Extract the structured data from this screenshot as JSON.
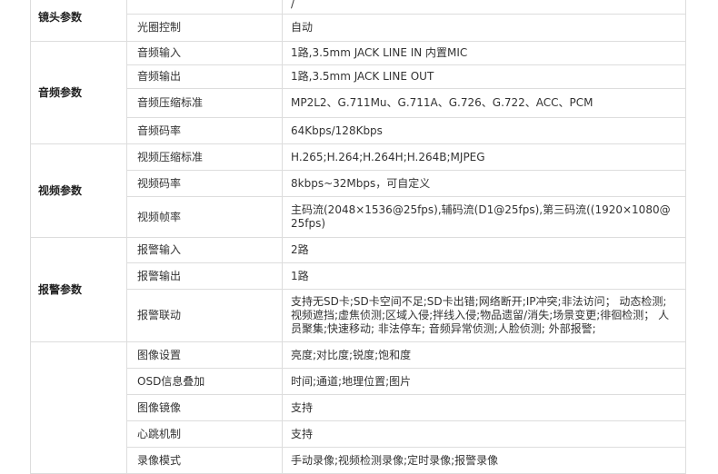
{
  "groups": [
    {
      "category": "镜头参数",
      "rows": [
        {
          "name": "",
          "value": "/"
        },
        {
          "name": "光圈控制",
          "value": "自动"
        }
      ]
    },
    {
      "category": "音频参数",
      "rows": [
        {
          "name": "音频输入",
          "value": "1路,3.5mm JACK LINE IN 内置MIC"
        },
        {
          "name": "音频输出",
          "value": "1路,3.5mm JACK LINE OUT"
        },
        {
          "name": "音频压缩标准",
          "value": "MP2L2、G.711Mu、G.711A、G.726、G.722、ACC、PCM"
        },
        {
          "name": "音频码率",
          "value": "64Kbps/128Kbps"
        }
      ]
    },
    {
      "category": "视频参数",
      "rows": [
        {
          "name": "视频压缩标准",
          "value": "H.265;H.264;H.264H;H.264B;MJPEG"
        },
        {
          "name": "视频码率",
          "value": "8kbps~32Mbps，可自定义"
        },
        {
          "name": "视频帧率",
          "value": "主码流(2048×1536@25fps),辅码流(D1@25fps),第三码流((1920×1080@25fps)"
        }
      ]
    },
    {
      "category": "报警参数",
      "rows": [
        {
          "name": "报警输入",
          "value": "2路"
        },
        {
          "name": "报警输出",
          "value": "1路"
        },
        {
          "name": "报警联动",
          "value": "支持无SD卡;SD卡空间不足;SD卡出错;网络断开;IP冲突;非法访问； 动态检测;视频遮挡;虚焦侦测;区域入侵;拌线入侵;物品遗留/消失;场景变更;徘徊检测； 人员聚集;快速移动; 非法停车; 音频异常侦测;人脸侦测; 外部报警;"
        }
      ]
    },
    {
      "category": "",
      "rows": [
        {
          "name": "图像设置",
          "value": "亮度;对比度;锐度;饱和度"
        },
        {
          "name": "OSD信息叠加",
          "value": "时间;通道;地理位置;图片"
        },
        {
          "name": "图像镜像",
          "value": "支持"
        },
        {
          "name": "心跳机制",
          "value": "支持"
        },
        {
          "name": "录像模式",
          "value": "手动录像;视频检测录像;定时录像;报警录像"
        }
      ]
    }
  ]
}
